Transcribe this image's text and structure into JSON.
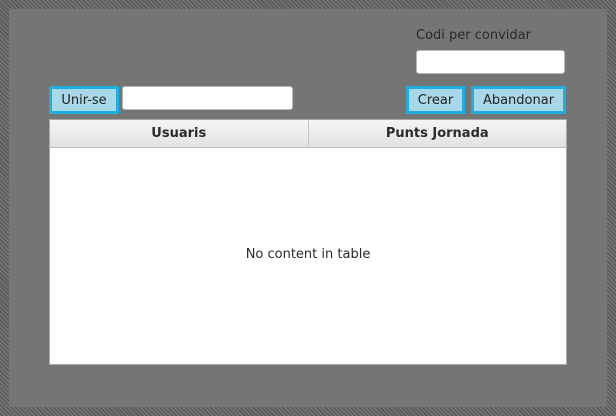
{
  "invite": {
    "label": "Codi per convidar",
    "value": "",
    "placeholder": ""
  },
  "join": {
    "button_label": "Unir-se",
    "code_value": "",
    "code_placeholder": ""
  },
  "actions": {
    "create_label": "Crear",
    "leave_label": "Abandonar"
  },
  "table": {
    "columns": [
      "Usuaris",
      "Punts Jornada"
    ],
    "rows": [],
    "empty_message": "No content in table"
  },
  "colors": {
    "button_fill": "#a8d7e8",
    "button_focus_border": "#1eaee0",
    "panel_background": "#757575"
  }
}
